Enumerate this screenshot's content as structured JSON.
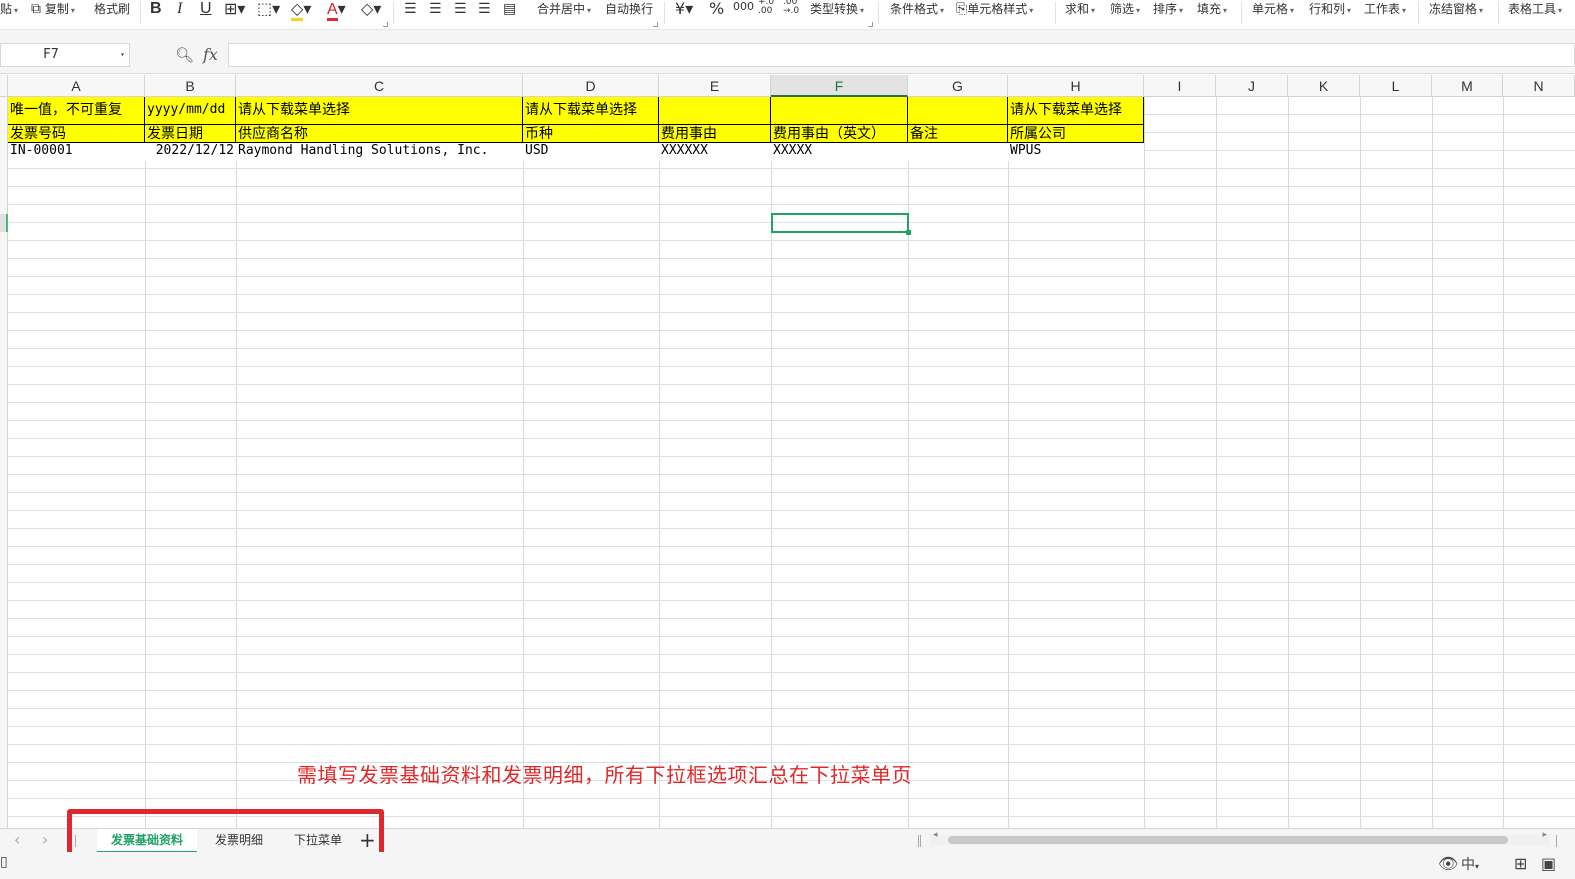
{
  "toolbar": {
    "paste_label": "贴",
    "copy_label": "复制",
    "format_painter_label": "格式刷",
    "merge_center_label": "合并居中",
    "wrap_text_label": "自动换行",
    "currency_symbol": "¥",
    "percent_symbol": "%",
    "thousands_label": "000",
    "inc_decimal_label": "+.0 .00",
    "dec_decimal_label": ".00 →.0",
    "type_convert_label": "类型转换",
    "conditional_format_label": "条件格式",
    "cell_style_label": "单元格样式",
    "sum_label": "求和",
    "filter_label": "筛选",
    "sort_label": "排序",
    "fill_label": "填充",
    "cell_label": "单元格",
    "row_col_label": "行和列",
    "worksheet_label": "工作表",
    "freeze_label": "冻结窗格",
    "table_tools_label": "表格工具"
  },
  "formula_bar": {
    "name_box": "F7",
    "formula_value": ""
  },
  "columns": [
    "A",
    "B",
    "C",
    "D",
    "E",
    "F",
    "G",
    "H",
    "I",
    "J",
    "K",
    "L",
    "M",
    "N"
  ],
  "selected_column": "F",
  "selected_cell": "F7",
  "rows": {
    "r1": {
      "A": "唯一值，不可重复",
      "B": "yyyy/mm/dd",
      "C": "请从下载菜单选择",
      "D": "请从下载菜单选择",
      "E": "",
      "F": "",
      "G": "",
      "H": "请从下载菜单选择"
    },
    "r2": {
      "A": "发票号码",
      "B": "发票日期",
      "C": "供应商名称",
      "D": "币种",
      "E": "费用事由",
      "F": "费用事由（英文）",
      "G": "备注",
      "H": "所属公司"
    },
    "r3": {
      "A": "IN-00001",
      "B": "2022/12/12",
      "C": "Raymond Handling Solutions, Inc.",
      "D": "USD",
      "E": "XXXXXX",
      "F": "XXXXX",
      "G": "",
      "H": "WPUS"
    }
  },
  "annotation": "需填写发票基础资料和发票明细，所有下拉框选项汇总在下拉菜单页",
  "sheet_tabs": [
    {
      "label": "发票基础资料",
      "active": true
    },
    {
      "label": "发票明细",
      "active": false
    },
    {
      "label": "下拉菜单",
      "active": false
    }
  ],
  "status": {
    "input_mode": "中"
  },
  "colors": {
    "header_fill": "#ffff00",
    "accent": "#21a366",
    "annotation_red": "#e02828"
  }
}
